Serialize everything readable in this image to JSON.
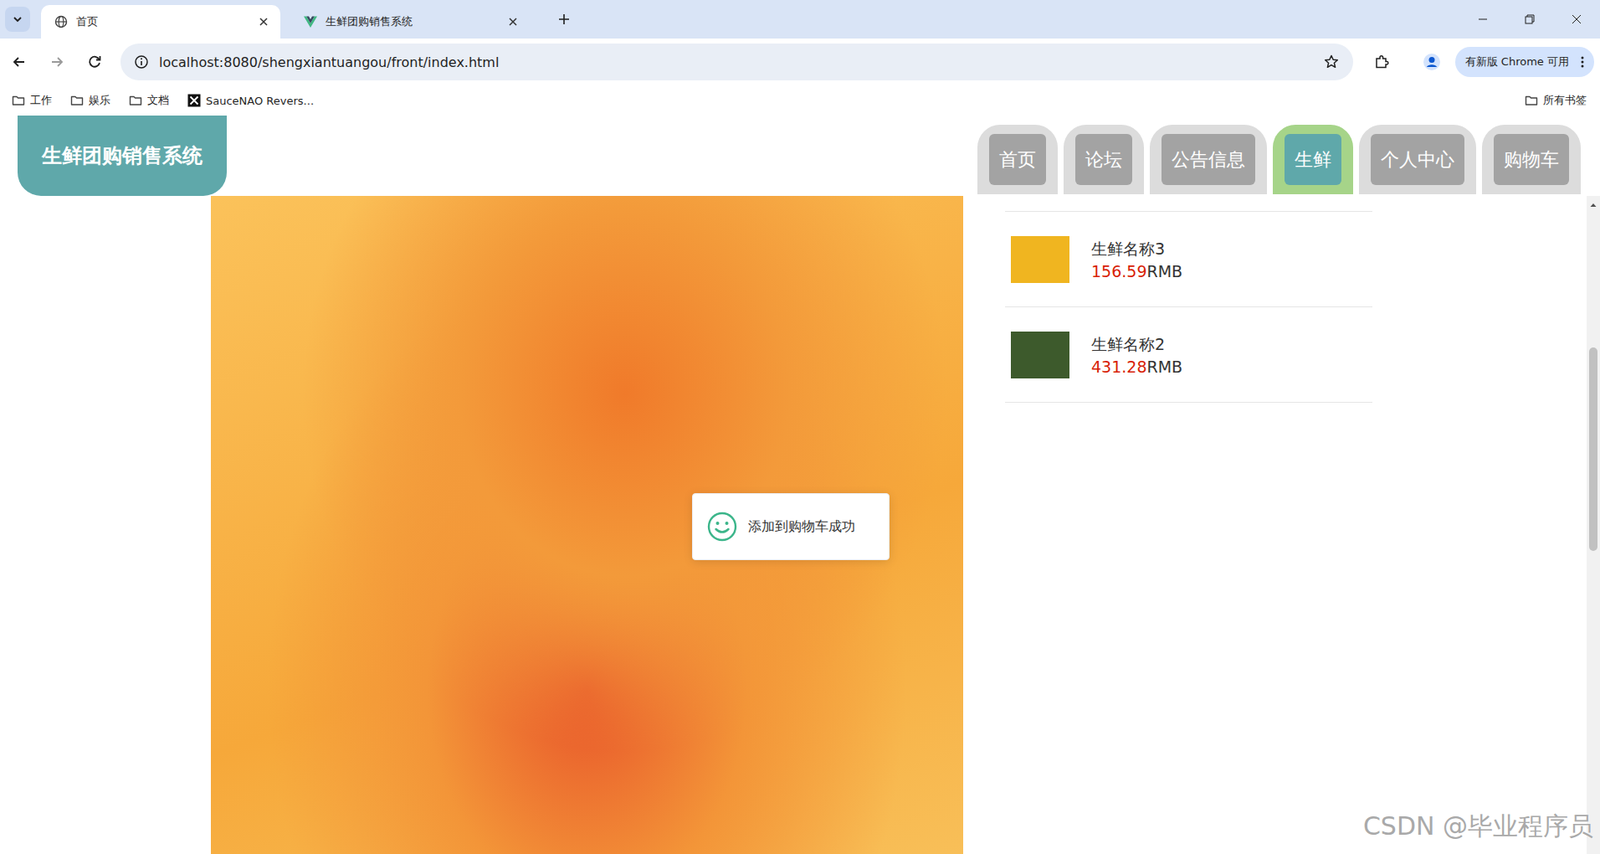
{
  "browser": {
    "tabs": [
      {
        "title": "首页",
        "selected": true,
        "kind": "web"
      },
      {
        "title": "生鲜团购销售系统",
        "selected": false,
        "kind": "vue"
      }
    ],
    "url": "localhost:8080/shengxiantuangou/front/index.html",
    "update_button": "有新版 Chrome 可用",
    "bookmarks": [
      {
        "label": "工作",
        "kind": "folder"
      },
      {
        "label": "娱乐",
        "kind": "folder"
      },
      {
        "label": "文档",
        "kind": "folder"
      },
      {
        "label": "SauceNAO Revers...",
        "kind": "site"
      }
    ],
    "all_bookmarks": "所有书签"
  },
  "page": {
    "logo": "生鲜团购销售系统",
    "nav": [
      {
        "label": "首页",
        "selected": false
      },
      {
        "label": "论坛",
        "selected": false
      },
      {
        "label": "公告信息",
        "selected": false
      },
      {
        "label": "生鲜",
        "selected": true
      },
      {
        "label": "个人中心",
        "selected": false
      },
      {
        "label": "购物车",
        "selected": false
      }
    ],
    "products": [
      {
        "name": "生鲜名称3",
        "price": "156.59",
        "unit": "RMB",
        "color": "#f0b520"
      },
      {
        "name": "生鲜名称2",
        "price": "431.28",
        "unit": "RMB",
        "color": "#3d5a2c"
      }
    ],
    "toast": {
      "message": "添加到购物车成功"
    }
  },
  "watermark": "CSDN @毕业程序员"
}
